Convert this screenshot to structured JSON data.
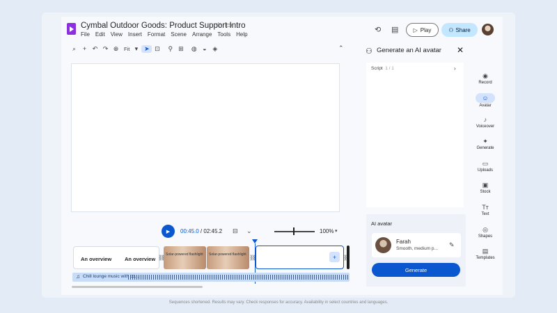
{
  "app": {
    "title": "Cymbal Outdoor Goods: Product Support Intro",
    "star_icon": "star-icon",
    "folder_icon": "folder-icon",
    "brand_color": "#8b2fe0"
  },
  "menu": [
    "File",
    "Edit",
    "View",
    "Insert",
    "Format",
    "Scene",
    "Arrange",
    "Tools",
    "Help"
  ],
  "header": {
    "play_label": "Play",
    "share_label": "Share",
    "accent": "#c2e7ff"
  },
  "toolbar": {
    "zoom_value": "Fit"
  },
  "playback": {
    "current_time": "00:45.0",
    "separator": " / ",
    "total_time": "02:45.2",
    "zoom_percent": "100%"
  },
  "timeline": {
    "text_clip_left": "An overview",
    "text_clip_right": "An overview",
    "image_clip_1": "Solar-powered flashlight",
    "image_clip_2": "Solar-powered flashlight",
    "add_label": "+",
    "audio_label": "Chill lounge music with co..."
  },
  "panel": {
    "title": "Generate an AI avatar",
    "script_label": "Script",
    "script_count": "1 / 1",
    "ai_avatar_label": "AI avatar",
    "avatar_name": "Farah",
    "avatar_desc": "Smooth, medium p...",
    "generate_label": "Generate",
    "primary": "#0b57d0"
  },
  "rail": [
    {
      "label": "Record",
      "icon": "◉"
    },
    {
      "label": "Avatar",
      "icon": "☺"
    },
    {
      "label": "Voiceover",
      "icon": "♪"
    },
    {
      "label": "Generate",
      "icon": "✦"
    },
    {
      "label": "Uploads",
      "icon": "▭"
    },
    {
      "label": "Stock",
      "icon": "▣"
    },
    {
      "label": "Text",
      "icon": "Tт"
    },
    {
      "label": "Shapes",
      "icon": "◎"
    },
    {
      "label": "Templates",
      "icon": "▤"
    }
  ],
  "footnote": "Sequences shortened. Results may vary. Check responses for accuracy. Availability in select countries and languages."
}
